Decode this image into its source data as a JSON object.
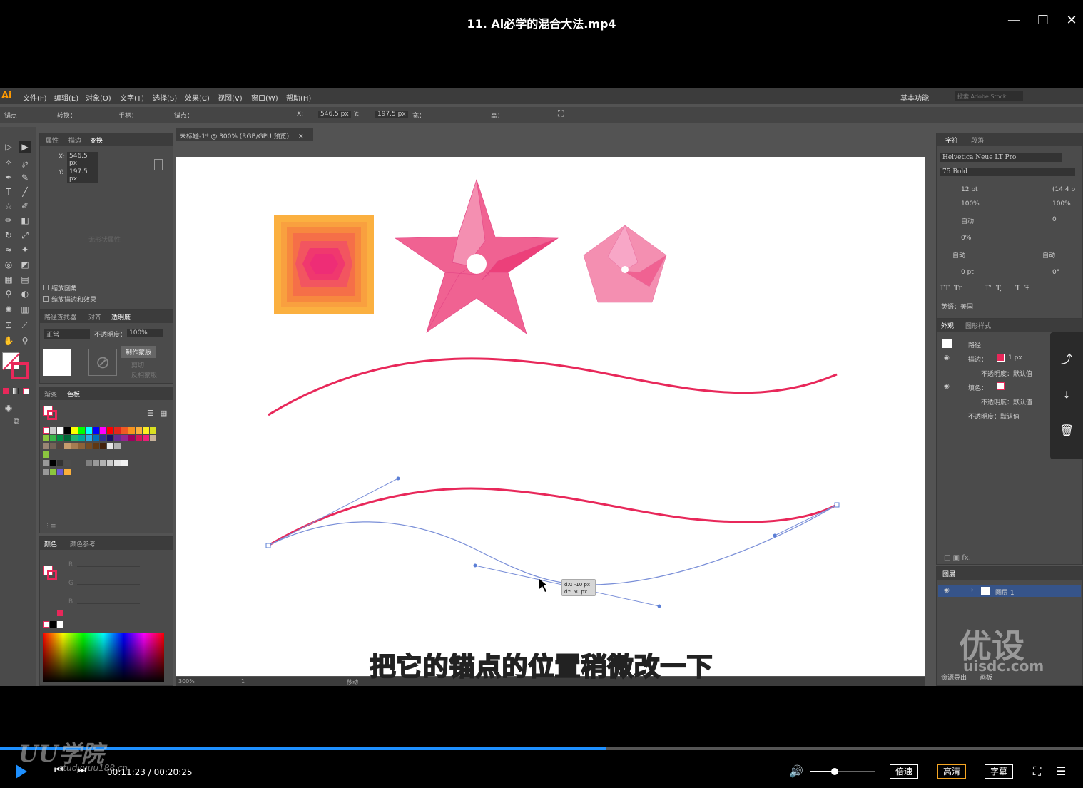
{
  "player": {
    "title": "11. Ai必学的混合大法.mp4",
    "current_time": "00:11:23",
    "total_time": "00:20:25",
    "progress_fraction": 0.559,
    "volume_fraction": 0.38,
    "speed_label": "倍速",
    "quality_label": "高清",
    "subtitle_label": "字幕",
    "subtitle_text": "把它的锚点的位置稍微改一下",
    "brand_logo": "UU学院",
    "brand_sub": "studyuuu188.cn"
  },
  "illustrator": {
    "logo": "Ai",
    "menus": [
      "文件(F)",
      "编辑(E)",
      "对象(O)",
      "文字(T)",
      "选择(S)",
      "效果(C)",
      "视图(V)",
      "窗口(W)",
      "帮助(H)"
    ],
    "workspace": "基本功能",
    "search_placeholder": "搜索 Adobe Stock",
    "control": {
      "anchor_label": "锚点",
      "convert_label": "转换：",
      "handle_label": "手柄：",
      "anchors_label": "锚点：",
      "x_label": "X:",
      "x_value": "546.5 px",
      "y_label": "Y:",
      "y_value": "197.5 px",
      "w_label": "宽：",
      "h_label": "高："
    },
    "doc_tab": "未标题-1* @ 300% (RGB/GPU 预览)",
    "left_panel": {
      "tabs": [
        "属性",
        "描边",
        "变换"
      ],
      "x_label": "X:",
      "x_value": "546.5 px",
      "y_label": "Y:",
      "y_value": "197.5 px",
      "no_props": "无形状属性",
      "scale_corners": "缩放圆角",
      "scale_strokes": "缩放描边和效果"
    },
    "transparency_panel": {
      "tabs": [
        "路径查找器",
        "对齐",
        "透明度"
      ],
      "mode": "正常",
      "opacity_label": "不透明度：",
      "opacity_value": "100%",
      "make_mask": "制作蒙版",
      "clip": "剪切",
      "invert_mask": "反相蒙版"
    },
    "swatch_panel": {
      "tabs": [
        "渐变",
        "色板"
      ]
    },
    "color_panel": {
      "tabs": [
        "颜色",
        "颜色参考"
      ],
      "channels": [
        "R",
        "G",
        "B"
      ]
    },
    "char_panel": {
      "tabs": [
        "字符",
        "段落"
      ],
      "font": "Helvetica Neue LT Pro",
      "style": "75 Bold",
      "size": "12 pt",
      "leading": "(14.4 p",
      "vscale": "100%",
      "hscale": "100%",
      "kerning": "自动",
      "tracking": "0",
      "tsume": "0%",
      "aki_left": "自动",
      "aki_right": "自动",
      "baseline": "0 pt",
      "rotation": "0°",
      "language": "英语：美国"
    },
    "appearance_panel": {
      "tabs": [
        "外观",
        "图形样式"
      ],
      "path_label": "路径",
      "stroke_label": "描边：",
      "stroke_value": "1 px",
      "opacity_default": "不透明度：默认值",
      "fill_label": "填色："
    },
    "layers_panel": {
      "tab": "图层",
      "layer_name": "图层 1",
      "footer_tabs": [
        "资源导出",
        "画板"
      ]
    },
    "status": {
      "zoom": "300%",
      "page": "1",
      "tool": "移动"
    },
    "tooltip": {
      "dx": "dX: -10 px",
      "dy": "dY: 50 px"
    }
  },
  "watermark": {
    "text": "优设",
    "url": "uisdc.com"
  },
  "colors": {
    "accent_pink": "#e8285a",
    "star_pink": "#f06292",
    "square_outer": "#fbb040",
    "path_blue": "#5b7fd6",
    "progress_blue": "#1e90ff",
    "hd_orange": "#f5a623"
  }
}
